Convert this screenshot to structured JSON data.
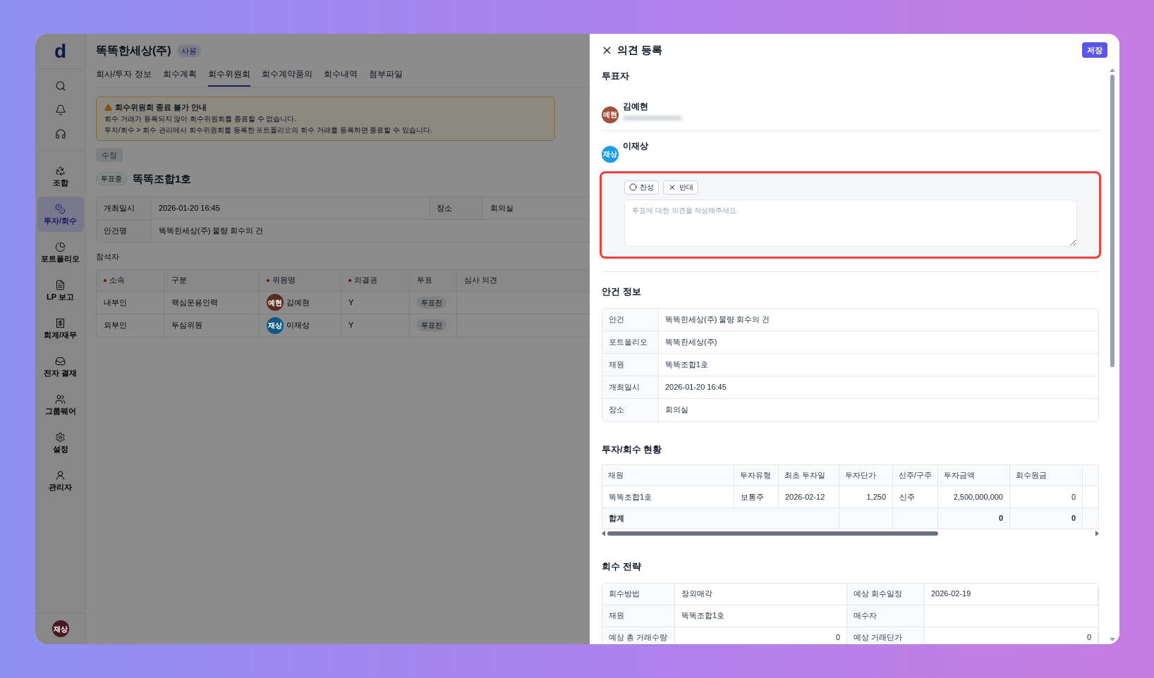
{
  "sidebar": {
    "logo": "d",
    "tools": [
      {
        "kind": "search"
      },
      {
        "kind": "bell"
      },
      {
        "kind": "headset"
      }
    ],
    "items": [
      {
        "kind": "fund",
        "label": "조합",
        "selected": false
      },
      {
        "kind": "invest",
        "label": "투자/회수",
        "selected": true
      },
      {
        "kind": "portfolio",
        "label": "포트폴리오",
        "selected": false
      },
      {
        "kind": "report",
        "label": "LP 보고",
        "selected": false
      },
      {
        "kind": "accounting",
        "label": "회계/재무",
        "selected": false
      },
      {
        "kind": "approval",
        "label": "전자 결재",
        "selected": false
      },
      {
        "kind": "groupware",
        "label": "그룹웨어",
        "selected": false
      },
      {
        "kind": "settings",
        "label": "설정",
        "selected": false
      },
      {
        "kind": "admin",
        "label": "관리자",
        "selected": false
      }
    ],
    "user": {
      "initials": "재상",
      "color": "#4a1820"
    }
  },
  "page": {
    "title": "똑똑한세상(주)",
    "status": "사용",
    "tabs": [
      {
        "label": "회사/투자 정보",
        "selected": false
      },
      {
        "label": "회수계획",
        "selected": false
      },
      {
        "label": "회수위원회",
        "selected": true
      },
      {
        "label": "회수계약품의",
        "selected": false
      },
      {
        "label": "회수내역",
        "selected": false
      },
      {
        "label": "첨부파일",
        "selected": false
      }
    ],
    "notice": {
      "title": "회수위원회 종료 불가 안내",
      "lines": [
        "회수 거래가 등록되지 않아 회수위원회를 종료할 수 없습니다.",
        "투자/회수 > 회수 관리에서 회수위원회를 등록한 포트폴리오의 회수 거래를 등록하면 종료할 수 있습니다."
      ]
    },
    "edit_button": {
      "label": "수정",
      "disabled": true
    },
    "fund": {
      "badge": "투표중",
      "name": "똑똑조합1호"
    },
    "meeting": {
      "date_label": "개최일시",
      "date": "2026-01-20 16:45",
      "place_label": "장소",
      "place": "회의실",
      "agenda_label": "안건명",
      "agenda": "똑똑한세상(주) 물량 회수의 건"
    },
    "attendees_label": "참석자",
    "attendees": {
      "columns": [
        {
          "label": "소속",
          "required": true
        },
        {
          "label": "구분",
          "required": false
        },
        {
          "label": "위원명",
          "required": true
        },
        {
          "label": "의결권",
          "required": true
        },
        {
          "label": "투표",
          "required": false
        },
        {
          "label": "심사 의견",
          "required": false
        }
      ],
      "rows": [
        {
          "affiliation": "내부인",
          "role": "핵심운용인력",
          "initials": "예현",
          "color": "#5a2c20",
          "name": "김예현",
          "vote_right": "Y",
          "vote": "투표전"
        },
        {
          "affiliation": "외부인",
          "role": "투심위원",
          "initials": "재상",
          "color": "#0f5a86",
          "name": "이재상",
          "vote_right": "Y",
          "vote": "투표전"
        }
      ]
    }
  },
  "panel": {
    "title": "의견 등록",
    "save": "저장",
    "voters_label": "투표자",
    "voters": [
      {
        "initials": "예현",
        "color": "#a0503c",
        "name": "김예현",
        "redacted_detail": true
      },
      {
        "initials": "재상",
        "color": "#1b9be8",
        "name": "이재상",
        "redacted_detail": false,
        "form": {
          "highlighted": true,
          "options": [
            {
              "kind": "approve",
              "label": "찬성",
              "selected": false
            },
            {
              "kind": "reject",
              "label": "반대",
              "selected": false
            }
          ],
          "placeholder": "투표에 대한 의견을 작성해주세요."
        }
      }
    ],
    "agenda_label": "안건 정보",
    "agenda": [
      {
        "label": "안건",
        "value": "똑똑한세상(주) 물량 회수의 건"
      },
      {
        "label": "포트폴리오",
        "value": "똑똑한세상(주)"
      },
      {
        "label": "재원",
        "value": "똑똑조합1호"
      },
      {
        "label": "개최일시",
        "value": "2026-01-20 16:45"
      },
      {
        "label": "장소",
        "value": "회의실"
      }
    ],
    "status_label": "투자/회수 현황",
    "status": {
      "columns": [
        "재원",
        "투자유형",
        "최초 투자일",
        "투자단가",
        "신주/구주",
        "투자금액",
        "회수원금"
      ],
      "row": [
        "똑똑조합1호",
        "보통주",
        "2026-02-12",
        "1,250",
        "신주",
        "2,500,000,000",
        "0"
      ],
      "total": {
        "label": "합계",
        "invest_amount": "0",
        "recovered": "0"
      }
    },
    "strategy_label": "회수 전략",
    "strategy": [
      [
        "회수방법",
        "장외매각",
        "예상 회수일정",
        "2026-02-19"
      ],
      [
        "재원",
        "똑똑조합1호",
        "매수자"
      ],
      [
        "예상 총 거래수량",
        "0",
        "예상 거래단가",
        "0"
      ]
    ]
  }
}
